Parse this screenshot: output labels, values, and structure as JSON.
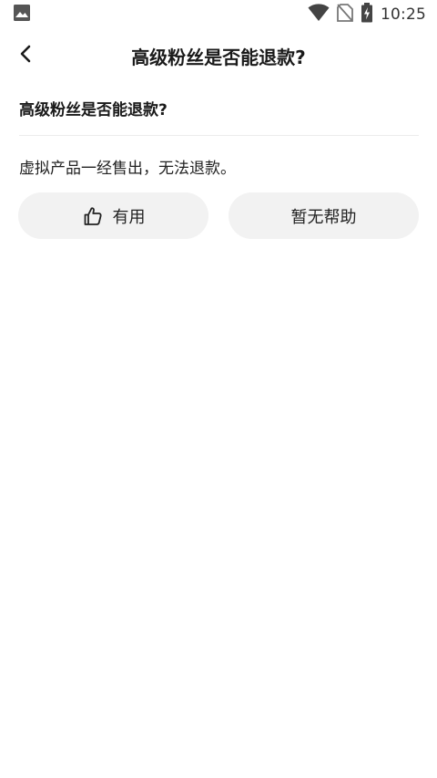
{
  "status_bar": {
    "time": "10:25",
    "icons": [
      "image-icon",
      "wifi-icon",
      "no-sim-icon",
      "battery-charging-icon"
    ]
  },
  "app_bar": {
    "title": "高级粉丝是否能退款?",
    "back_icon": "chevron-left-icon"
  },
  "faq": {
    "question": "高级粉丝是否能退款?",
    "answer": "虚拟产品一经售出，无法退款。"
  },
  "feedback": {
    "useful_label": "有用",
    "useful_icon": "thumbs-up-icon",
    "not_helpful_label": "暂无帮助"
  },
  "colors": {
    "background": "#ffffff",
    "pill_background": "#f2f2f2",
    "text": "#1a1a1a",
    "divider": "#ececec"
  }
}
